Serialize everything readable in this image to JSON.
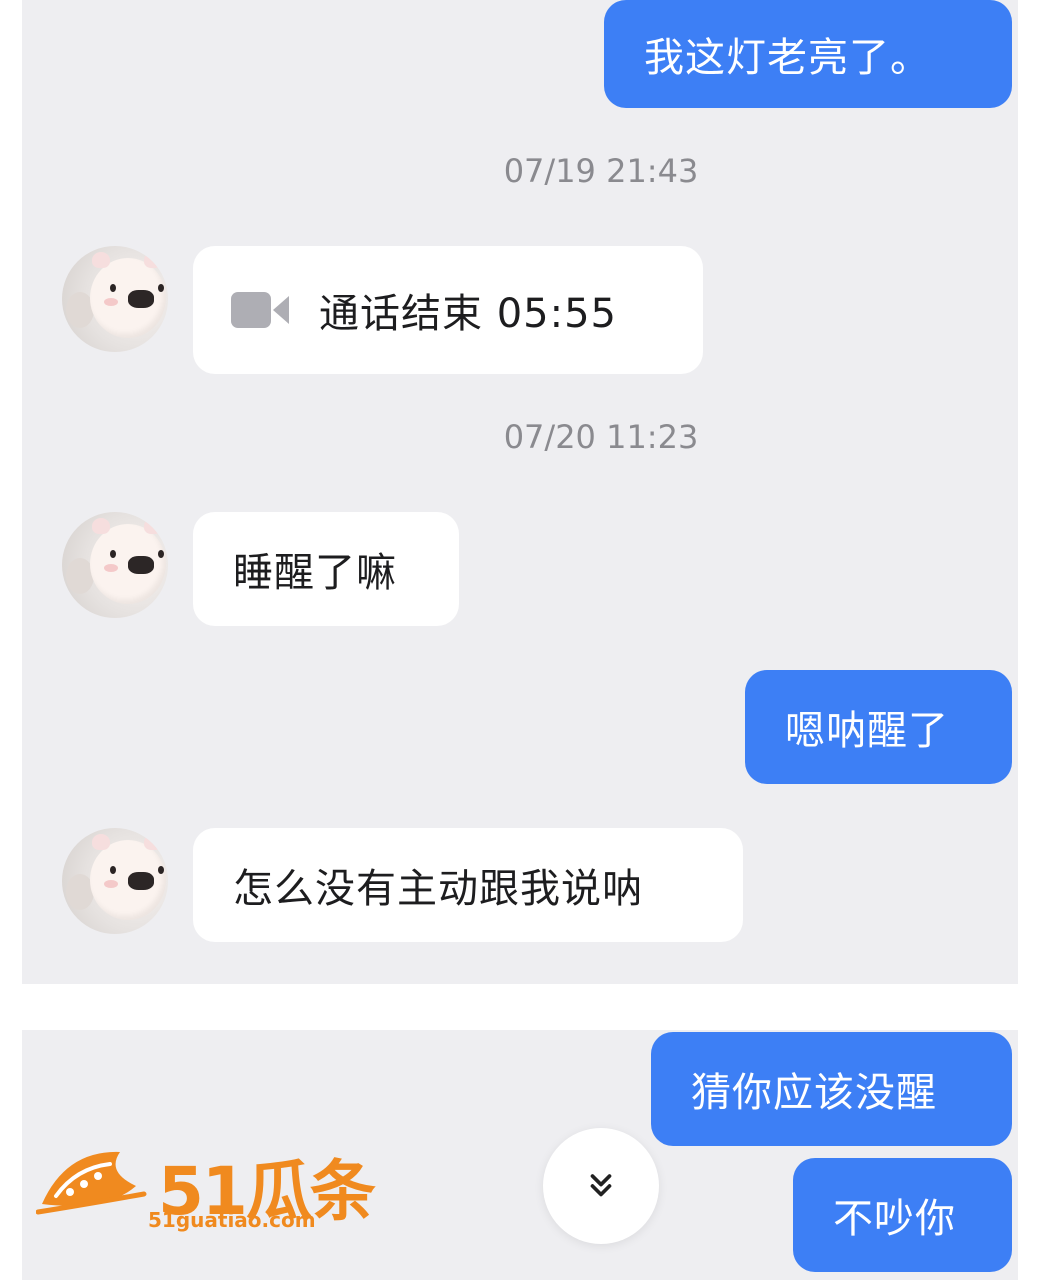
{
  "messages": [
    {
      "side": "out",
      "text": "我这灯老亮了。"
    },
    {
      "type": "timestamp",
      "text": "07/19 21:43"
    },
    {
      "side": "in",
      "icon": "video-call-icon",
      "text": "通话结束 05:55"
    },
    {
      "type": "timestamp",
      "text": "07/20 11:23"
    },
    {
      "side": "in",
      "text": "睡醒了嘛"
    },
    {
      "side": "out",
      "text": "嗯呐醒了"
    },
    {
      "side": "in",
      "text": "怎么没有主动跟我说呐"
    },
    {
      "side": "out",
      "text": "猜你应该没醒"
    },
    {
      "side": "out",
      "text": "不吵你"
    }
  ],
  "watermark": {
    "brand": "51瓜条",
    "domain": "51guatiao.com"
  },
  "icons": {
    "scroll_down": "double-chevron-down-icon",
    "call": "video-camera-icon",
    "avatar": "pig-avatar"
  },
  "colors": {
    "outgoing_bubble": "#3d7ff5",
    "incoming_bubble": "#ffffff",
    "chat_background": "#eeeef1",
    "timestamp_text": "#8a8a8f",
    "watermark": "#f08a1f"
  }
}
